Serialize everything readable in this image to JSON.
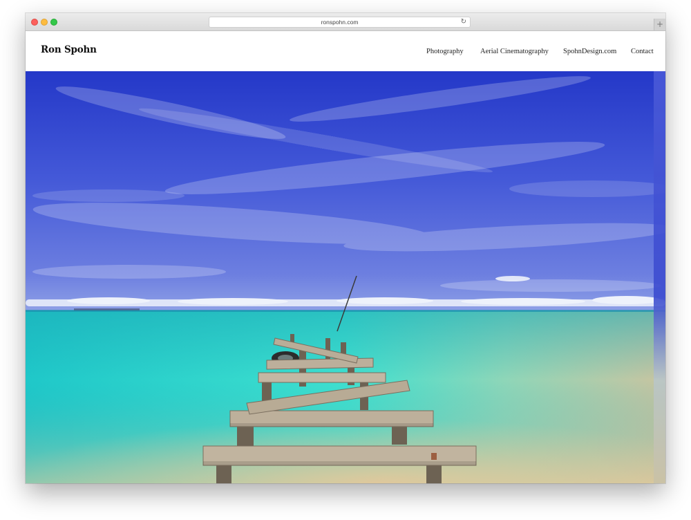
{
  "browser": {
    "url": "ronspohn.com",
    "reload_glyph": "↻",
    "new_tab_glyph": "+"
  },
  "site": {
    "logo": "Ron Spohn",
    "nav": [
      {
        "label": "Photography"
      },
      {
        "label": "Aerial Cinematography"
      },
      {
        "label": "SpohnDesign.com"
      },
      {
        "label": "Contact"
      }
    ]
  },
  "hero": {
    "subject": "broken wooden pier over turquoise lagoon under blue sky",
    "colors": {
      "sky_top": "#2a3fd0",
      "sky_mid": "#4b62de",
      "horizon_clouds": "#e8eef8",
      "lagoon": "#33d6cf",
      "shallow_sand": "#d7c79e",
      "wood": "#b5a995"
    }
  }
}
